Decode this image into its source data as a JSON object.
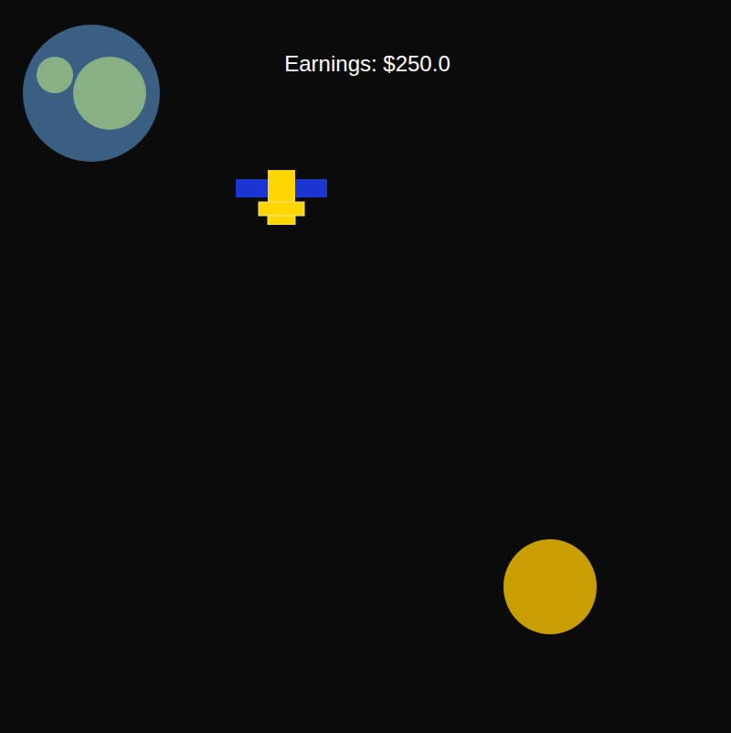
{
  "hud": {
    "earnings": "Earnings: $250.0"
  }
}
